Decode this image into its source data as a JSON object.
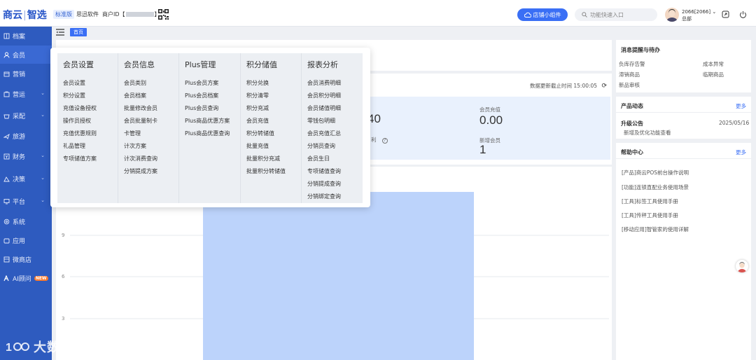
{
  "header": {
    "logo_a": "商云",
    "logo_b": "智选",
    "edition": "标准版",
    "software": "思迅软件",
    "merchant_label": "商户ID【",
    "merchant_suffix": "】",
    "widget_button": "店铺小组件",
    "search_placeholder": "功能快速入口",
    "user_name": "2066[2066] ⌄",
    "user_role": "总部"
  },
  "sidebar": {
    "items": [
      {
        "label": "档案",
        "icon": "archive-icon"
      },
      {
        "label": "会员",
        "icon": "user-icon"
      },
      {
        "label": "营销",
        "icon": "marketing-icon"
      },
      {
        "label": "营运",
        "icon": "operations-icon"
      },
      {
        "label": "采配",
        "icon": "purchase-icon"
      },
      {
        "label": "旅游",
        "icon": "travel-icon"
      },
      {
        "label": "财务",
        "icon": "finance-icon"
      },
      {
        "label": "决策",
        "icon": "decision-icon"
      },
      {
        "label": "平台",
        "icon": "platform-icon"
      },
      {
        "label": "系统",
        "icon": "system-icon"
      },
      {
        "label": "应用",
        "icon": "apps-icon"
      },
      {
        "label": "微商店",
        "icon": "store-icon"
      },
      {
        "label": "AI顾问",
        "icon": "ai-icon"
      }
    ],
    "hot_badge": "NEW"
  },
  "breadcrumb": {
    "tab": "首页"
  },
  "stats": {
    "update_time": "数据更新截止时间 15:00:05",
    "partial_value": "40",
    "partial_label": "利",
    "member_recharge_label": "会员充值",
    "member_recharge_value": "0.00",
    "new_member_label": "新增会员",
    "new_member_value": "1"
  },
  "chart_data": {
    "type": "bar",
    "yticks": [
      "9",
      "6",
      "3"
    ]
  },
  "right": {
    "todo_title": "消息提醒与待办",
    "todo_items": [
      "负库存告警",
      "成本异常",
      "滞销商品",
      "临期商品",
      "新品审核"
    ],
    "news_title": "产品动态",
    "news_more": "更多",
    "news_item_title": "升级公告",
    "news_item_date": "2025/05/16",
    "news_item_desc": "新增及优化功能查看",
    "help_title": "帮助中心",
    "help_more": "更多",
    "help_links": [
      "[产品]商云POS前台操作说明",
      "[功能]连锁直配业务使用场景",
      "[工具]标签工具使用手册",
      "[工具]传秤工具使用手册",
      "[移动应用]智管家的使用详解"
    ]
  },
  "mega_menu": {
    "columns": [
      {
        "title": "会员设置",
        "items": [
          "会员设置",
          "积分设置",
          "充值设备授权",
          "操作员授权",
          "充值优惠规则",
          "礼品管理",
          "专项储值方案"
        ]
      },
      {
        "title": "会员信息",
        "items": [
          "会员类别",
          "会员档案",
          "批量修改会员",
          "会员批量制卡",
          "卡管理",
          "计次方案",
          "计次消费查询",
          "分销提成方案"
        ]
      },
      {
        "title": "Plus管理",
        "items": [
          "Plus会员方案",
          "Plus会员档案",
          "Plus会员查询",
          "Plus商品优惠方案",
          "Plus商品优惠查询"
        ]
      },
      {
        "title": "积分储值",
        "items": [
          "积分兑换",
          "积分清零",
          "积分充减",
          "会员充值",
          "积分转储值",
          "批量充值",
          "批量积分充减",
          "批量积分转储值"
        ]
      },
      {
        "title": "报表分析",
        "items": [
          "会员消费明细",
          "会员积分明细",
          "会员储值明细",
          "零钱包明细",
          "会员充值汇总",
          "分销员查询",
          "会员生日",
          "专项储值查询",
          "分销提成查询",
          "分销绑定查询"
        ]
      }
    ]
  },
  "watermark": "大数跨境",
  "watermark_mark": "1"
}
